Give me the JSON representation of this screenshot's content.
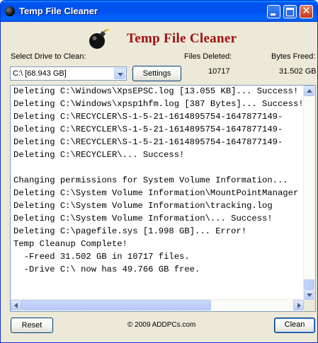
{
  "window": {
    "title": "Temp File Cleaner"
  },
  "header": {
    "heading": "Temp File Cleaner",
    "logo_icon": "bomb-icon"
  },
  "drive": {
    "label": "Select Drive to Clean:",
    "selected": "C:\\ [68.943 GB]"
  },
  "settings_label": "Settings",
  "stats": {
    "files_deleted_label": "Files Deleted:",
    "files_deleted_value": "10717",
    "bytes_freed_label": "Bytes Freed:",
    "bytes_freed_value": "31.502 GB"
  },
  "log": {
    "lines": [
      "Deleting C:\\Windows\\XpsEPSC.log [13.055 KB]... Success!",
      "Deleting C:\\Windows\\xpsp1hfm.log [387 Bytes]... Success!",
      "Deleting C:\\RECYCLER\\S-1-5-21-1614895754-1647877149-",
      "Deleting C:\\RECYCLER\\S-1-5-21-1614895754-1647877149-",
      "Deleting C:\\RECYCLER\\S-1-5-21-1614895754-1647877149-",
      "Deleting C:\\RECYCLER\\... Success!",
      "",
      "Changing permissions for System Volume Information...",
      "Deleting C:\\System Volume Information\\MountPointManager",
      "Deleting C:\\System Volume Information\\tracking.log",
      "Deleting C:\\System Volume Information\\... Success!",
      "Deleting C:\\pagefile.sys [1.998 GB]... Error!",
      "Temp Cleanup Complete!",
      "  -Freed 31.502 GB in 10717 files.",
      "  -Drive C:\\ now has 49.766 GB free."
    ]
  },
  "footer": {
    "reset_label": "Reset",
    "copyright": "© 2009 ADDPCs.com",
    "clean_label": "Clean"
  }
}
